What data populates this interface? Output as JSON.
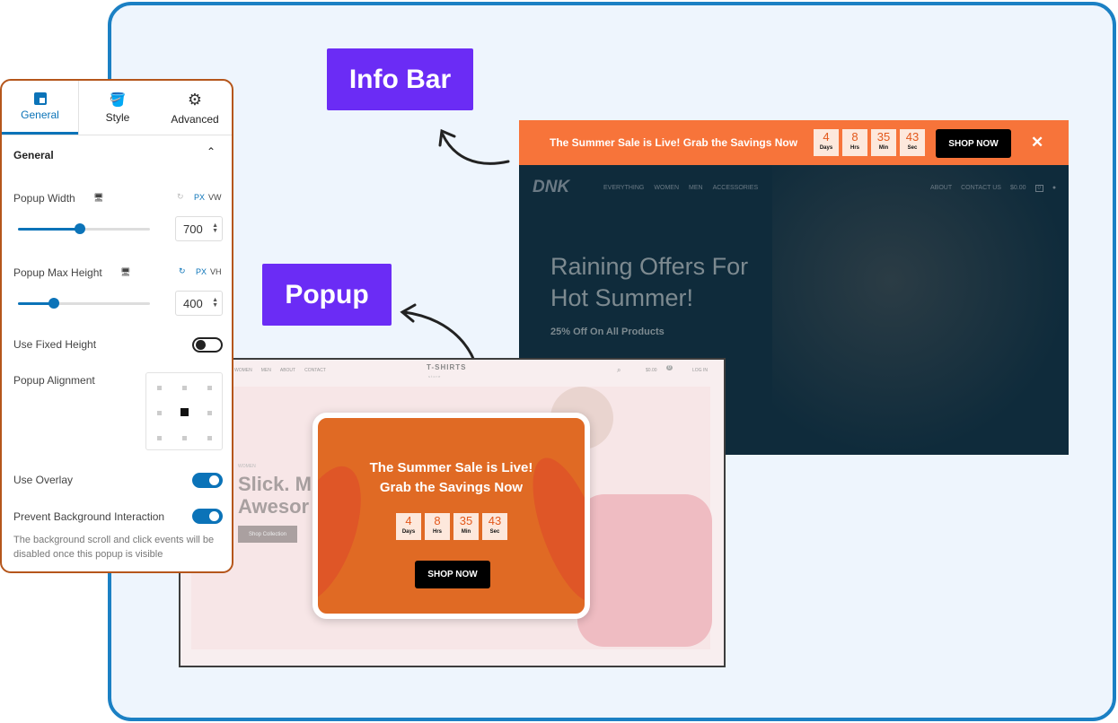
{
  "labels": {
    "info_bar": "Info Bar",
    "popup": "Popup"
  },
  "colors": {
    "accent_purple": "#6b2cf5",
    "frame_blue": "#1b80c4",
    "infobar_orange": "#f7743a",
    "popup_orange": "#e06a24",
    "settings_blue": "#0b73b8"
  },
  "infobar_site": {
    "message": "The Summer Sale is Live! Grab the Savings Now",
    "countdown": [
      {
        "value": "4",
        "unit": "Days"
      },
      {
        "value": "8",
        "unit": "Hrs"
      },
      {
        "value": "35",
        "unit": "Min"
      },
      {
        "value": "43",
        "unit": "Sec"
      }
    ],
    "button": "SHOP NOW",
    "close": "✕",
    "logo": "DNK",
    "nav": [
      "EVERYTHING",
      "WOMEN",
      "MEN",
      "ACCESSORIES"
    ],
    "nav_right": [
      "ABOUT",
      "CONTACT US",
      "$0.00"
    ],
    "cart_count": "0",
    "hero_title_1": "Raining Offers For",
    "hero_title_2": "Hot Summer!",
    "hero_sub": "25% Off On All Products"
  },
  "popup_site": {
    "nav": [
      "WOMEN",
      "MEN",
      "ABOUT",
      "CONTACT"
    ],
    "logo": "T-SHIRTS",
    "logo_sub": "s t o r e",
    "price": "$0.00",
    "cart_count": "0",
    "login": "LOG IN",
    "eyebrow": "WOMEN",
    "hero_1": "Slick. M",
    "hero_2": "Awesor",
    "hero_button": "Shop Collection",
    "popup_title_1": "The Summer Sale is Live!",
    "popup_title_2": "Grab the Savings Now",
    "countdown": [
      {
        "value": "4",
        "unit": "Days"
      },
      {
        "value": "8",
        "unit": "Hrs"
      },
      {
        "value": "35",
        "unit": "Min"
      },
      {
        "value": "43",
        "unit": "Sec"
      }
    ],
    "popup_button": "SHOP NOW"
  },
  "panel": {
    "tabs": [
      {
        "label": "General",
        "active": true
      },
      {
        "label": "Style"
      },
      {
        "label": "Advanced"
      }
    ],
    "section": "General",
    "popup_width": {
      "label": "Popup Width",
      "value": "700",
      "units": [
        "PX",
        "VW"
      ],
      "slider_percent": 47
    },
    "popup_max_height": {
      "label": "Popup Max Height",
      "value": "400",
      "units": [
        "PX",
        "VH"
      ],
      "slider_percent": 27
    },
    "fixed_height": {
      "label": "Use Fixed Height",
      "on": false
    },
    "alignment": {
      "label": "Popup Alignment",
      "selected": "center"
    },
    "overlay": {
      "label": "Use Overlay",
      "on": true
    },
    "prevent_bg": {
      "label": "Prevent Background Interaction",
      "on": true
    },
    "help": "The background scroll and click events will be disabled once this popup is visible"
  }
}
